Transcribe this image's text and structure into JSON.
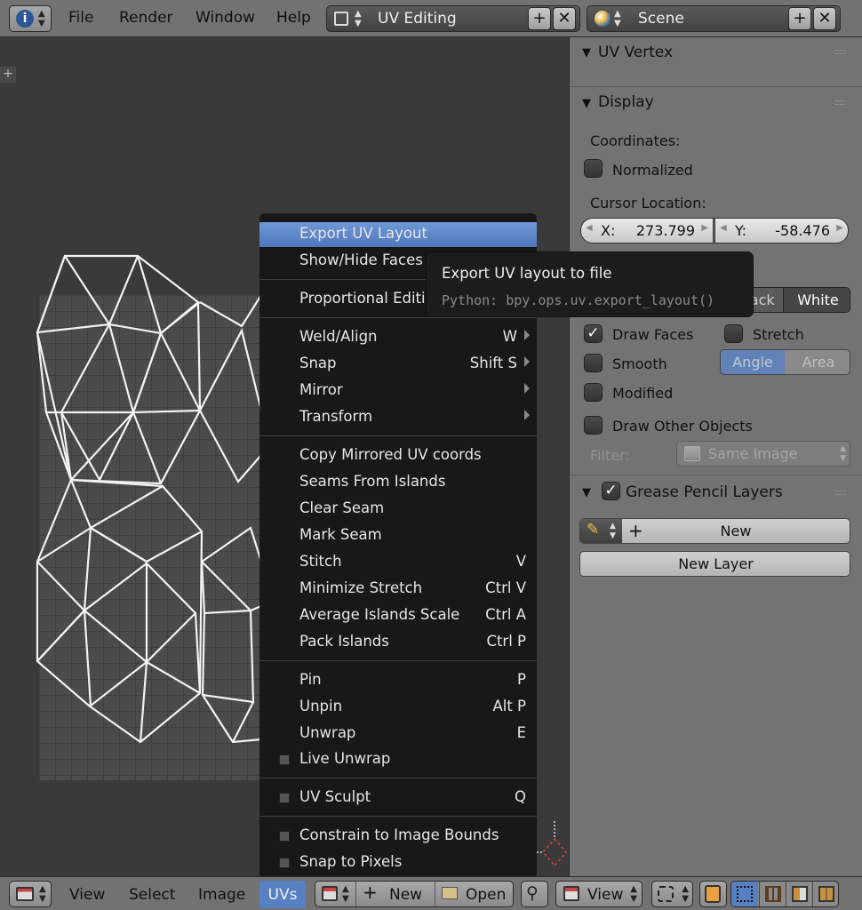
{
  "topbar": {
    "menus": [
      "File",
      "Render",
      "Window",
      "Help"
    ],
    "screen_layout": "UV Editing",
    "scene": "Scene"
  },
  "right_panel": {
    "uv_vertex_title": "UV Vertex",
    "display_title": "Display",
    "coordinates_label": "Coordinates:",
    "normalized_label": "Normalized",
    "normalized_checked": false,
    "cursor_location_label": "Cursor Location:",
    "cursor_x_label": "X:",
    "cursor_x_value": "273.799",
    "cursor_y_label": "Y:",
    "cursor_y_value": "-58.476",
    "partial_label": ":",
    "black_label": "Black",
    "white_label": "White",
    "draw_faces_label": "Draw Faces",
    "draw_faces_checked": true,
    "stretch_label": "Stretch",
    "smooth_label": "Smooth",
    "angle_label": "Angle",
    "area_label": "Area",
    "modified_label": "Modified",
    "draw_other_objects_label": "Draw Other Objects",
    "filter_label": "Filter:",
    "filter_value": "Same Image",
    "grease_pencil_title": "Grease Pencil Layers",
    "new_label": "New",
    "new_layer_label": "New Layer"
  },
  "uvs_menu": {
    "items": [
      {
        "label": "Export UV Layout",
        "shortcut": "",
        "submenu": false
      },
      {
        "label": "Show/Hide Faces",
        "shortcut": "",
        "submenu": false
      },
      {
        "label": "Proportional Editing",
        "shortcut": "",
        "submenu": false
      },
      {
        "label": "Weld/Align",
        "shortcut": "W",
        "submenu": true
      },
      {
        "label": "Snap",
        "shortcut": "Shift S",
        "submenu": true
      },
      {
        "label": "Mirror",
        "shortcut": "",
        "submenu": true
      },
      {
        "label": "Transform",
        "shortcut": "",
        "submenu": true
      },
      {
        "label": "Copy Mirrored UV coords",
        "shortcut": "",
        "submenu": false
      },
      {
        "label": "Seams From Islands",
        "shortcut": "",
        "submenu": false
      },
      {
        "label": "Clear Seam",
        "shortcut": "",
        "submenu": false
      },
      {
        "label": "Mark Seam",
        "shortcut": "",
        "submenu": false
      },
      {
        "label": "Stitch",
        "shortcut": "V",
        "submenu": false
      },
      {
        "label": "Minimize Stretch",
        "shortcut": "Ctrl V",
        "submenu": false
      },
      {
        "label": "Average Islands Scale",
        "shortcut": "Ctrl A",
        "submenu": false
      },
      {
        "label": "Pack Islands",
        "shortcut": "Ctrl P",
        "submenu": false
      },
      {
        "label": "Pin",
        "shortcut": "P",
        "submenu": false
      },
      {
        "label": "Unpin",
        "shortcut": "Alt P",
        "submenu": false
      },
      {
        "label": "Unwrap",
        "shortcut": "E",
        "submenu": false
      },
      {
        "label": "Live Unwrap",
        "shortcut": "",
        "submenu": false
      },
      {
        "label": "UV Sculpt",
        "shortcut": "Q",
        "submenu": false
      },
      {
        "label": "Constrain to Image Bounds",
        "shortcut": "",
        "submenu": false
      },
      {
        "label": "Snap to Pixels",
        "shortcut": "",
        "submenu": false
      }
    ]
  },
  "tooltip": {
    "title": "Export UV layout to file",
    "python": "Python: bpy.ops.uv.export_layout()"
  },
  "bottombar": {
    "menus": [
      "View",
      "Select",
      "Image",
      "UVs"
    ],
    "active_menu": "UVs",
    "new_label": "New",
    "open_label": "Open",
    "view_label": "View"
  },
  "colors": {
    "highlight": "#5680c2",
    "panel_bg": "#737373",
    "menu_bg": "#161616"
  }
}
